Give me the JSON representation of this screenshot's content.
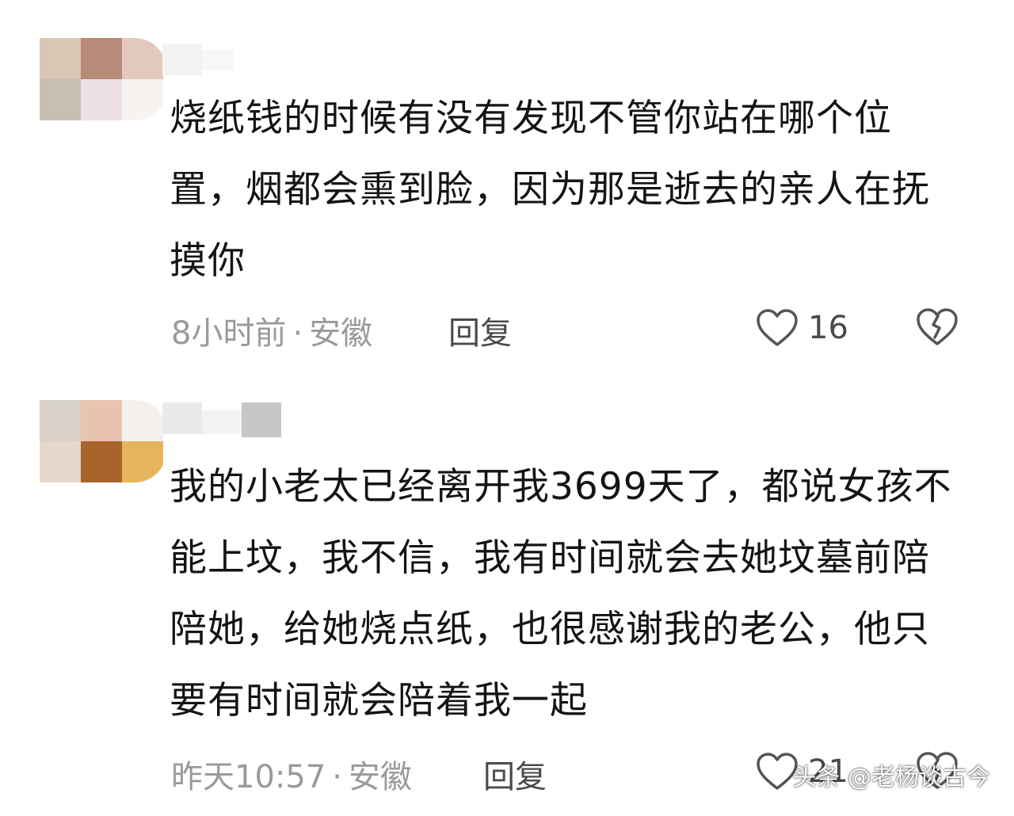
{
  "comments": [
    {
      "text": "烧纸钱的时候有没有发现不管你站在哪个位置，烟都会熏到脸，因为那是逝去的亲人在抚摸你",
      "time": "8小时前",
      "location": "安徽",
      "reply_label": "回复",
      "like_count": "16",
      "avatar_icon": "mosaic-avatar"
    },
    {
      "text": "我的小老太已经离开我3699天了，都说女孩不能上坟，我不信，我有时间就会去她坟墓前陪陪她，给她烧点纸，也很感谢我的老公，他只要有时间就会陪着我一起",
      "time": "昨天10:57",
      "location": "安徽",
      "reply_label": "回复",
      "like_count": "21",
      "avatar_icon": "mosaic-avatar"
    }
  ],
  "meta_separator": "·",
  "watermark": "头条 @老杨谈古今",
  "colors": {
    "text": "#141414",
    "meta": "#9a9a9a",
    "action": "#4a4a4a",
    "icon_stroke": "#555555"
  },
  "icons": {
    "like": "heart-outline-icon",
    "dislike": "broken-heart-icon"
  }
}
